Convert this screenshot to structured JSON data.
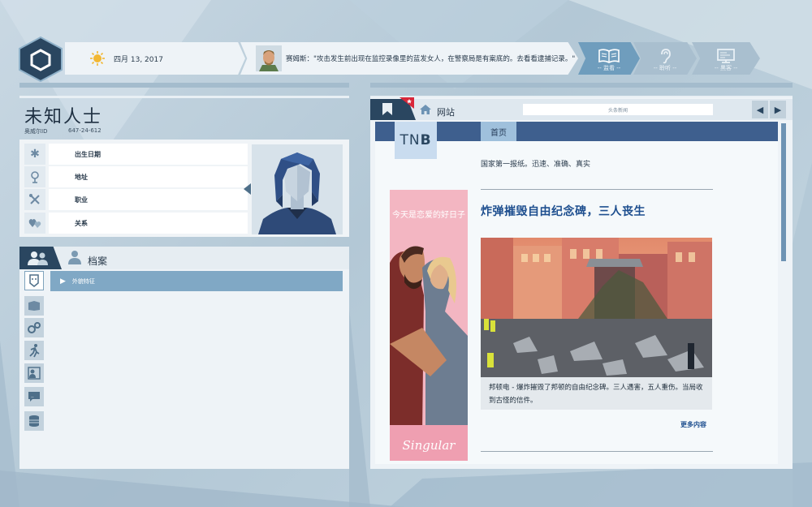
{
  "top_bar": {
    "date": "四月 13, 2017",
    "message": "赛姆斯：\"攻击发生前出现在监控录像里的蓝发女人，在警察局是有案底的。去看看逮捕记录。\"",
    "nav": [
      {
        "label": "-- 监看 --",
        "icon": "book-icon",
        "active": true
      },
      {
        "label": "-- 聆听 --",
        "icon": "ear-icon",
        "active": false
      },
      {
        "label": "-- 黑客 --",
        "icon": "monitor-icon",
        "active": false
      }
    ]
  },
  "profile": {
    "name": "未知人士",
    "id_label": "奥威尔ID",
    "id_value": "647-24-612",
    "fields": [
      {
        "label": "出生日期",
        "icon": "asterisk-icon"
      },
      {
        "label": "地址",
        "icon": "location-icon"
      },
      {
        "label": "职业",
        "icon": "tools-icon"
      },
      {
        "label": "关系",
        "icon": "hearts-icon"
      }
    ]
  },
  "file": {
    "title": "档案",
    "selected_entry": "外貌特征",
    "side_icons": [
      "face-icon",
      "book-icon",
      "gears-icon",
      "runner-icon",
      "person-card-icon",
      "chat-icon",
      "database-icon"
    ]
  },
  "browser": {
    "site_label": "网站",
    "url": "头条新闻",
    "nav_prev": "◀",
    "nav_next": "▶",
    "page": {
      "logo": "TN",
      "logo_bold": "B",
      "home_tab": "首页",
      "tagline": "国家第一报纸。迅速、准确、真实",
      "ad_text": "今天是恋爱的好日子",
      "ad_brand": "Singular",
      "headline": "炸弹摧毁自由纪念碑，三人丧生",
      "caption": "邦顿电 - 爆炸摧毁了邦顿的自由纪念碑。三人遇害，五人重伤。当局收到古怪的信件。",
      "more": "更多内容"
    }
  },
  "colors": {
    "dark_navy": "#2a4660",
    "accent_blue": "#6f9dbd",
    "headline_blue": "#1e4f8f",
    "nav_bar": "#3e5f8e"
  }
}
